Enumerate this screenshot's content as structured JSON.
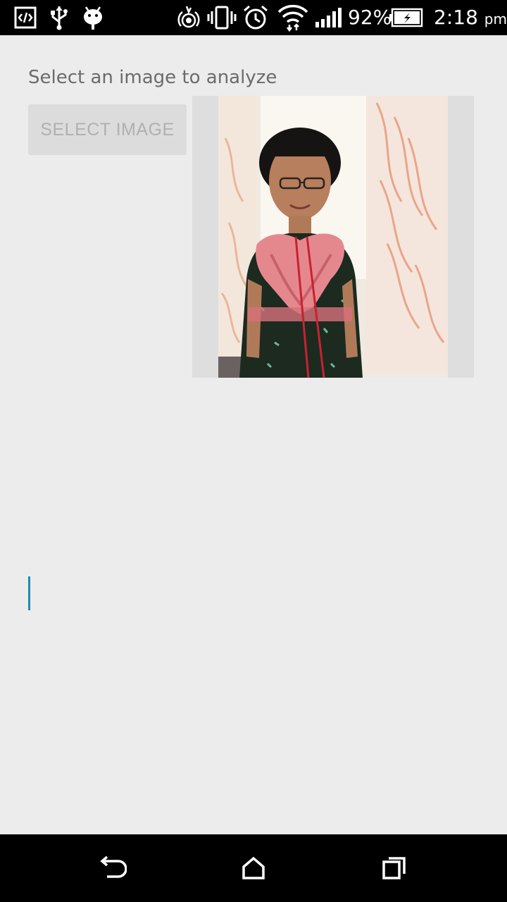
{
  "status_bar": {
    "left_icons": [
      "developer-mode-icon",
      "usb-icon",
      "android-debug-icon"
    ],
    "right_icons": [
      "hotspot-icon",
      "vibrate-icon",
      "alarm-icon",
      "wifi-icon",
      "signal-icon",
      "battery-charging-icon"
    ],
    "battery_percent": "92%",
    "battery_level": 0.92,
    "time": "2:18",
    "ampm": "pm"
  },
  "main": {
    "prompt": "Select an image to analyze",
    "select_button_label": "SELECT IMAGE",
    "selected_image": "portrait-photo",
    "result_text": ""
  },
  "nav_bar": {
    "buttons": [
      "back-icon",
      "home-icon",
      "recents-icon"
    ]
  },
  "colors": {
    "background": "#ececec",
    "status_bar": "#000000",
    "cursor": "#1e8bb5",
    "button_bg": "#dcdcdc",
    "button_text": "#b0b0b0"
  }
}
